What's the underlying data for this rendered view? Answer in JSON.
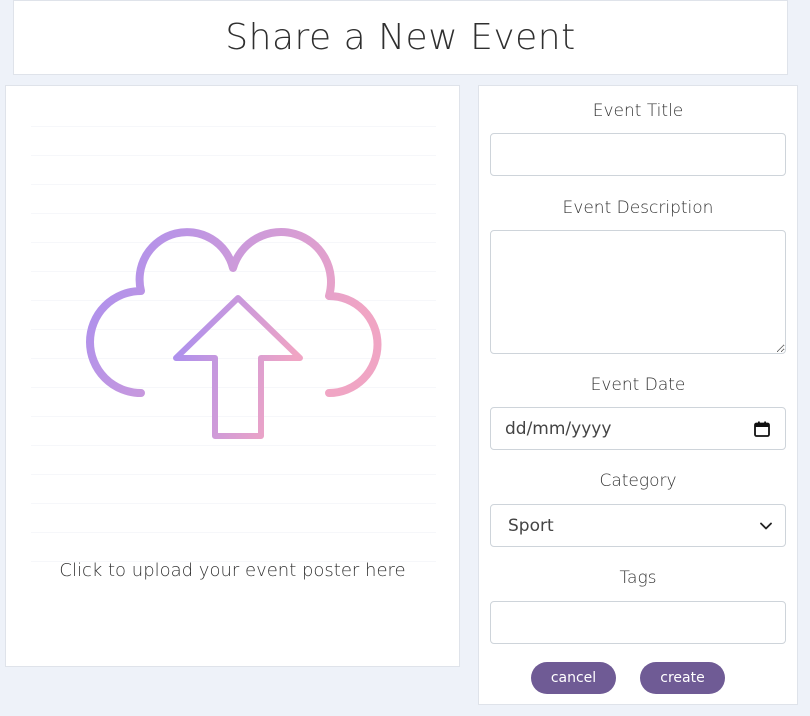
{
  "header": {
    "title": "Share a New Event"
  },
  "upload": {
    "label": "Click to upload your event poster here",
    "icon": "cloud-upload-icon",
    "gradient": [
      "#a88ef0",
      "#efa5c6"
    ]
  },
  "form": {
    "title_label": "Event Title",
    "title_value": "",
    "description_label": "Event Description",
    "description_value": "",
    "date_label": "Event Date",
    "date_placeholder": "dd/mm/yyyy",
    "category_label": "Category",
    "category_value": "Sport",
    "tags_label": "Tags",
    "tags_value": ""
  },
  "buttons": {
    "cancel": "cancel",
    "create": "create"
  },
  "colors": {
    "accent": "#6f5b95",
    "background": "#eef2f9"
  }
}
